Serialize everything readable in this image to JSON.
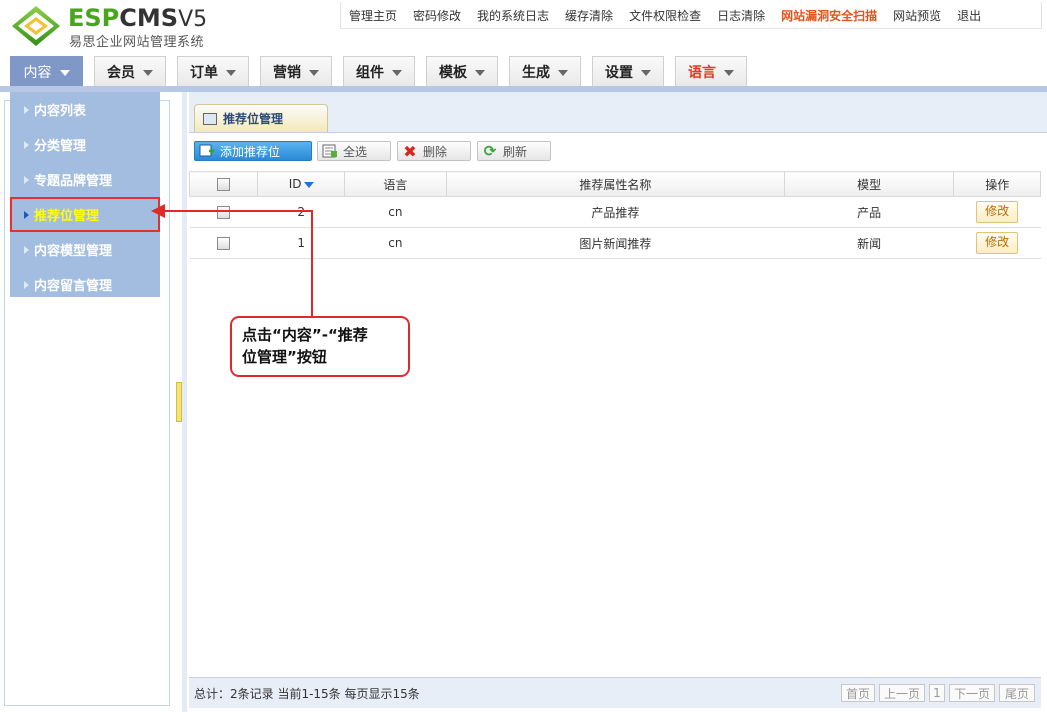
{
  "brand": {
    "logo_text_esp": "ESP",
    "logo_text_cms": "CMS",
    "logo_text_ver": "V5",
    "subtitle": "易思企业网站管理系统"
  },
  "top_links": [
    {
      "label": "管理主页"
    },
    {
      "label": "密码修改"
    },
    {
      "label": "我的系统日志"
    },
    {
      "label": "缓存清除"
    },
    {
      "label": "文件权限检查"
    },
    {
      "label": "日志清除"
    },
    {
      "label": "网站漏洞安全扫描",
      "highlight": true
    },
    {
      "label": "网站预览"
    },
    {
      "label": "退出"
    }
  ],
  "main_tabs": [
    {
      "label": "内容",
      "active": true
    },
    {
      "label": "会员"
    },
    {
      "label": "订单"
    },
    {
      "label": "营销"
    },
    {
      "label": "组件"
    },
    {
      "label": "模板"
    },
    {
      "label": "生成"
    },
    {
      "label": "设置"
    },
    {
      "label": "语言",
      "highlight": true
    }
  ],
  "sidebar": {
    "items": [
      {
        "label": "内容列表"
      },
      {
        "label": "分类管理"
      },
      {
        "label": "专题品牌管理"
      },
      {
        "label": "推荐位管理",
        "selected": true
      },
      {
        "label": "内容模型管理"
      },
      {
        "label": "内容留言管理"
      }
    ]
  },
  "panel": {
    "tab_title": "推荐位管理",
    "toolbar": {
      "add_label": "添加推荐位",
      "select_all_label": "全选",
      "delete_label": "删除",
      "refresh_label": "刷新"
    },
    "columns": {
      "id": "ID",
      "language": "语言",
      "name": "推荐属性名称",
      "model": "模型",
      "action": "操作"
    },
    "rows": [
      {
        "id": "2",
        "language": "cn",
        "name": "产品推荐",
        "model": "产品",
        "action": "修改"
      },
      {
        "id": "1",
        "language": "cn",
        "name": "图片新闻推荐",
        "model": "新闻",
        "action": "修改"
      }
    ],
    "footer": {
      "summary": "总计：2条记录 当前1-15条 每页显示15条",
      "first": "首页",
      "prev": "上一页",
      "page": "1",
      "next": "下一页",
      "last": "尾页"
    }
  },
  "annotation": {
    "line1": "点击“内容”-“推荐",
    "line2": "位管理”按钮"
  },
  "colors": {
    "active_tab": "#7f98c7",
    "sidebar_bg": "#a2bde0",
    "selected_text": "#ffff00",
    "annotation_red": "#e02a2a",
    "warn_text": "#e2531d"
  }
}
